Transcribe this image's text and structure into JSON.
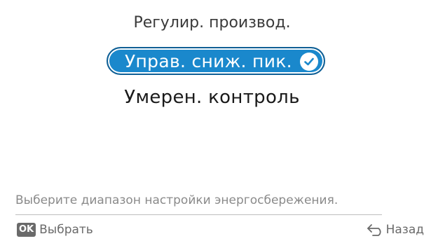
{
  "menu": {
    "title": "Регулир. производ.",
    "options": [
      {
        "label": "Управ. сниж. пик.",
        "selected": true
      },
      {
        "label": "Умерен. контроль",
        "selected": false
      }
    ]
  },
  "hint": "Выберите диапазон настройки энергосбережения.",
  "footer": {
    "ok_badge": "OK",
    "ok_label": "Выбрать",
    "back_label": "Назад"
  },
  "colors": {
    "accent": "#1a88cc",
    "text": "#1a1a1a",
    "muted": "#8a8a8a"
  },
  "icons": {
    "selected": "check-circle-icon",
    "back": "back-arrow-icon"
  }
}
